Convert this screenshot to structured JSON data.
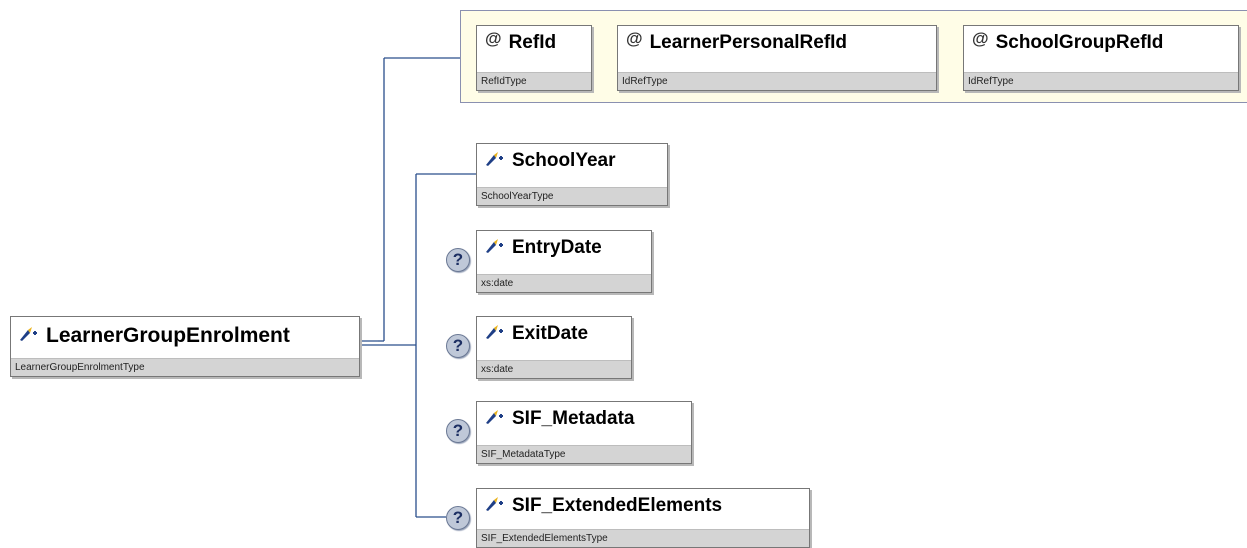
{
  "root": {
    "name": "LearnerGroupEnrolment",
    "type": "LearnerGroupEnrolmentType"
  },
  "attributes": [
    {
      "name": "RefId",
      "type": "RefIdType"
    },
    {
      "name": "LearnerPersonalRefId",
      "type": "IdRefType"
    },
    {
      "name": "SchoolGroupRefId",
      "type": "IdRefType"
    }
  ],
  "elements": [
    {
      "name": "SchoolYear",
      "type": "SchoolYearType",
      "optional": false
    },
    {
      "name": "EntryDate",
      "type": "xs:date",
      "optional": true
    },
    {
      "name": "ExitDate",
      "type": "xs:date",
      "optional": true
    },
    {
      "name": "SIF_Metadata",
      "type": "SIF_MetadataType",
      "optional": true
    },
    {
      "name": "SIF_ExtendedElements",
      "type": "SIF_ExtendedElementsType",
      "optional": true
    }
  ],
  "icons": {
    "attribute": "at-sign-icon",
    "element": "element-arrow-icon",
    "optional": "question-icon"
  },
  "optional_glyph": "?",
  "attribute_glyph": "@",
  "colors": {
    "connector": "#2a4f8c",
    "attribute_group_bg": "#fffde7",
    "type_bar": "#d4d4d4",
    "optional_icon": "#bfc8d8"
  }
}
